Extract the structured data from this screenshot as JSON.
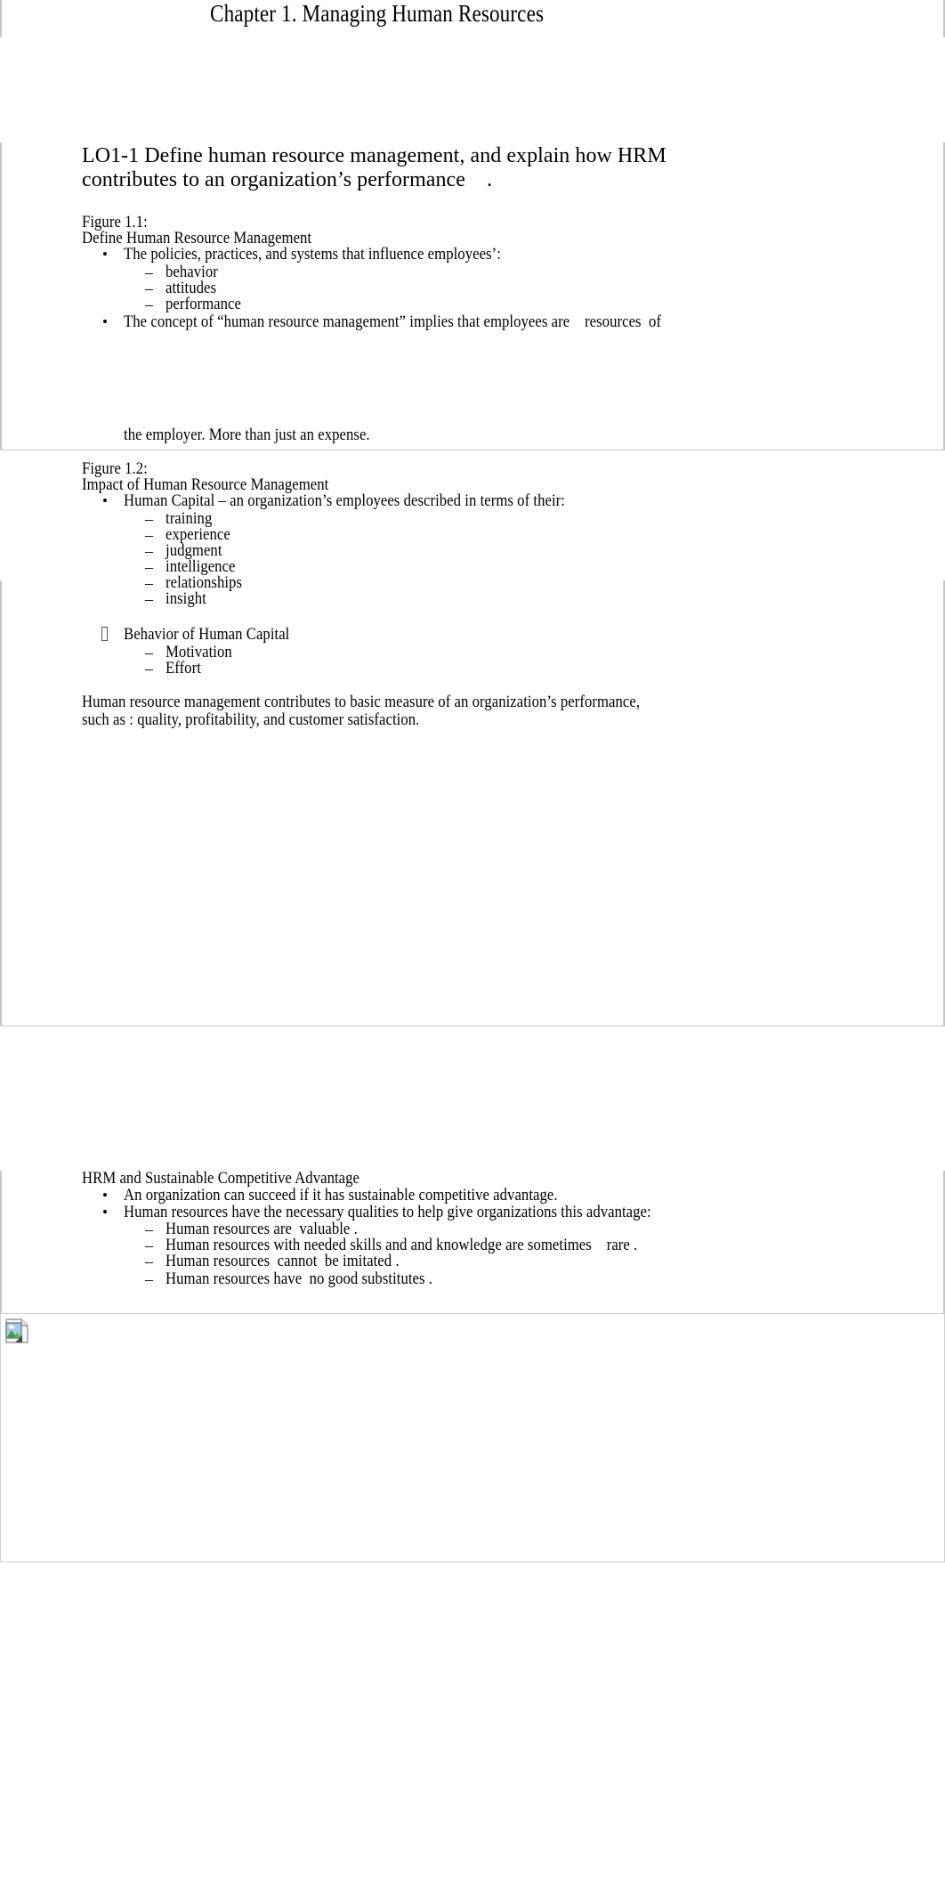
{
  "document": {
    "title": "Chapter 1. Managing Human Resources",
    "page_count_visible": 4
  },
  "sections": {
    "learning_objective": {
      "line1": "LO1-1 Define human resource management, and explain how HRM",
      "line2": "contributes to an organization’s performance    ."
    },
    "figure_1_1": {
      "label": "Figure 1.1:",
      "heading": "Define Human Resource Management",
      "bullets": [
        {
          "marker": "•",
          "text": "The policies, practices, and systems that influence employees’:",
          "sub": [
            {
              "marker": "–",
              "text": "behavior"
            },
            {
              "marker": "–",
              "text": "attitudes"
            },
            {
              "marker": "–",
              "text": "performance"
            }
          ]
        },
        {
          "marker": "•",
          "text": "The concept of “human resource management” implies that employees are    resources  of",
          "continuation": "the employer. More than just an expense.",
          "sub": []
        }
      ]
    },
    "figure_1_2": {
      "label": "Figure 1.2:",
      "heading": "Impact of Human Resource Management",
      "bullets": [
        {
          "marker": "•",
          "text": "Human Capital – an organization’s employees described in terms of their:",
          "sub": [
            {
              "marker": "–",
              "text": "training"
            },
            {
              "marker": "–",
              "text": "experience"
            },
            {
              "marker": "–",
              "text": "judgment"
            },
            {
              "marker": "–",
              "text": "intelligence"
            },
            {
              "marker": "–",
              "text": "relationships"
            },
            {
              "marker": "–",
              "text": "insight"
            }
          ]
        },
        {
          "marker": "missing-glyph-box",
          "text": "Behavior of Human Capital",
          "sub": [
            {
              "marker": "–",
              "text": "Motivation"
            },
            {
              "marker": "–",
              "text": "Effort"
            }
          ]
        }
      ],
      "paragraph": {
        "line1": "Human resource management contributes to basic measure of an organization’s performance,",
        "line2": "such as : quality, profitability, and customer satisfaction."
      }
    },
    "sustainable_advantage": {
      "heading": "HRM and Sustainable Competitive Advantage",
      "bullets": [
        {
          "marker": "•",
          "text": "An organization can succeed if it has sustainable competitive advantage.",
          "sub": []
        },
        {
          "marker": "•",
          "text": "Human resources have the necessary qualities to help give organizations this advantage:",
          "sub": [
            {
              "marker": "–",
              "text": "Human resources are  valuable ."
            },
            {
              "marker": "–",
              "text": "Human resources with needed skills and and knowledge are sometimes    rare ."
            },
            {
              "marker": "–",
              "text": "Human resources  cannot  be imitated ."
            },
            {
              "marker": "–",
              "text": "Human resources have  no good substitutes ."
            }
          ]
        }
      ]
    }
  },
  "image_placeholder": {
    "icon": "broken-image-icon",
    "alt": ""
  },
  "colors": {
    "text": "#000000",
    "rule": "#c6c6c6",
    "page_break": "#c9c9c9",
    "icon_sky": "#9fc6e8",
    "icon_hill": "#46a546",
    "icon_page": "#f4f4f4",
    "icon_outline": "#808080",
    "icon_cloud": "#ffffff"
  }
}
